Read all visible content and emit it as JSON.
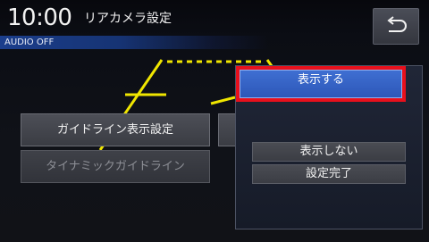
{
  "header": {
    "clock": "10:00",
    "title": "リアカメラ設定",
    "audio_status": "AUDIO OFF"
  },
  "back_button": {
    "icon": "return-arrow-icon"
  },
  "menu": {
    "guideline_display": "ガイドライン表示設定",
    "dynamic_guideline": "タイナミックガイドライン"
  },
  "popup": {
    "options": {
      "show": "表示する",
      "hide": "表示しない",
      "done": "設定完了"
    },
    "selected": "show"
  },
  "colors": {
    "guide_line": "#f0e600",
    "selection_border": "#e8101c",
    "selected_fill": "#3a66c8"
  }
}
